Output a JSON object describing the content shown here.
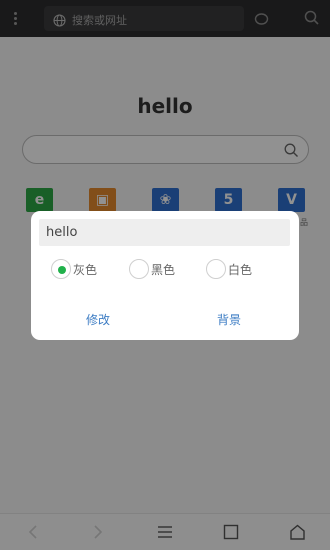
{
  "browser": {
    "url_placeholder": "搜索或网址"
  },
  "home": {
    "title": "hello",
    "shortcuts": [
      {
        "icon": "e-letter-icon",
        "glyph": "e",
        "color": "#2ca845",
        "label": ""
      },
      {
        "icon": "cat-icon",
        "glyph": "▣",
        "color": "#e58a2c",
        "label": ""
      },
      {
        "icon": "paw-icon",
        "glyph": "❀",
        "color": "#2f6fd0",
        "label": ""
      },
      {
        "icon": "s-letter-icon",
        "glyph": "5",
        "color": "#2f6fd0",
        "label": ""
      },
      {
        "icon": "v-letter-icon",
        "glyph": "V",
        "color": "#2f6fd0",
        "label": "品"
      }
    ]
  },
  "dialog": {
    "input_value": "hello",
    "options": [
      {
        "label": "灰色",
        "selected": true
      },
      {
        "label": "黑色",
        "selected": false
      },
      {
        "label": "白色",
        "selected": false
      }
    ],
    "edit_button": "修改",
    "background_button": "背景"
  },
  "colors": {
    "accent_green": "#21b14b",
    "button_blue": "#3d7dc4"
  }
}
